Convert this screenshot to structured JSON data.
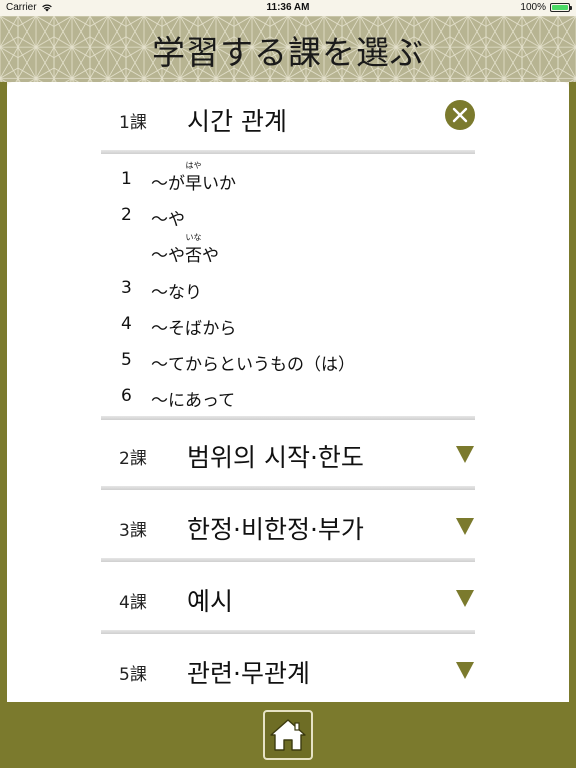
{
  "status_bar": {
    "carrier": "Carrier",
    "time": "11:36 AM",
    "battery": "100%",
    "battery_level": 1.0
  },
  "header": {
    "title": "学習する課を選ぶ"
  },
  "colors": {
    "olive": "#7b7a2d",
    "header_bg": "#b7b492",
    "white": "#ffffff"
  },
  "lessons": [
    {
      "num": "1課",
      "name": "시간 관계",
      "expanded": true,
      "action_icon": "close-icon"
    },
    {
      "num": "2課",
      "name": "범위의 시작·한도",
      "expanded": false,
      "action_icon": "triangle-down-icon"
    },
    {
      "num": "3課",
      "name": "한정·비한정·부가",
      "expanded": false,
      "action_icon": "triangle-down-icon"
    },
    {
      "num": "4課",
      "name": "예시",
      "expanded": false,
      "action_icon": "triangle-down-icon"
    },
    {
      "num": "5課",
      "name": "관련·무관계",
      "expanded": false,
      "action_icon": "triangle-down-icon"
    }
  ],
  "sub_items": [
    {
      "num": "1",
      "pre": "～が",
      "ruby_base": "早",
      "ruby": "はや",
      "post": "いか"
    },
    {
      "num": "2",
      "pre": "～や",
      "ruby_base": "",
      "ruby": "",
      "post": ""
    },
    {
      "num": "",
      "pre": "～や",
      "ruby_base": "否",
      "ruby": "いな",
      "post": "や"
    },
    {
      "num": "3",
      "pre": "～なり",
      "ruby_base": "",
      "ruby": "",
      "post": ""
    },
    {
      "num": "4",
      "pre": "～そばから",
      "ruby_base": "",
      "ruby": "",
      "post": ""
    },
    {
      "num": "5",
      "pre": "～てからというもの（は）",
      "ruby_base": "",
      "ruby": "",
      "post": ""
    },
    {
      "num": "6",
      "pre": "～にあって",
      "ruby_base": "",
      "ruby": "",
      "post": ""
    }
  ],
  "bottom_bar": {
    "home_icon": "home-icon"
  }
}
